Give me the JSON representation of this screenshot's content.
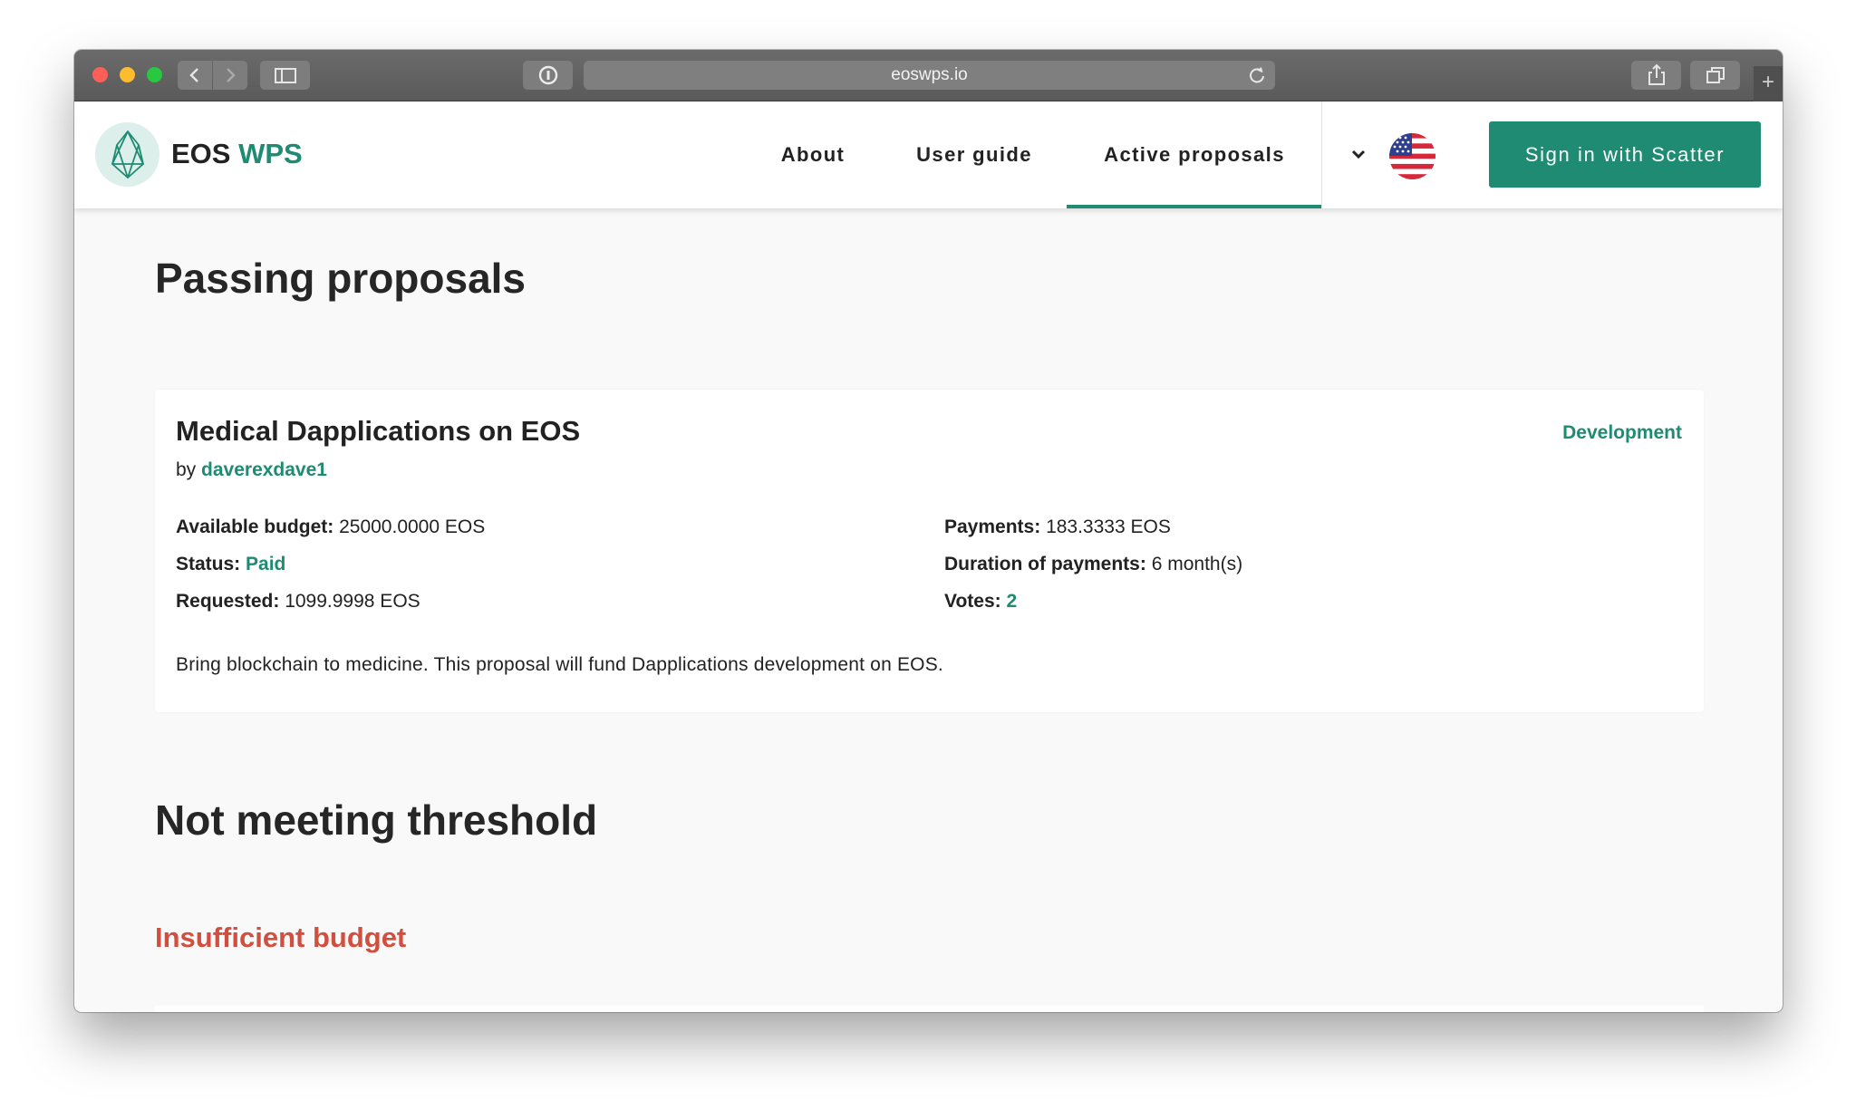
{
  "browser": {
    "url": "eoswps.io",
    "new_tab_label": "+"
  },
  "header": {
    "brand_primary": "EOS",
    "brand_accent": "WPS",
    "nav": [
      {
        "label": "About"
      },
      {
        "label": "User guide"
      },
      {
        "label": "Active proposals",
        "active": true
      }
    ],
    "language_flag": "us-flag-icon",
    "signin_label": "Sign in with Scatter"
  },
  "colors": {
    "accent": "#1f8b73",
    "warning": "#d04f3f",
    "text": "#222222",
    "page_bg": "#f9f9f9"
  },
  "sections": {
    "passing_title": "Passing proposals",
    "not_meeting_title": "Not meeting threshold",
    "insufficient_title": "Insufficient budget"
  },
  "proposal": {
    "title": "Medical Dapplications on EOS",
    "category": "Development",
    "by_prefix": "by",
    "author": "daverexdave1",
    "available_budget_label": "Available budget:",
    "available_budget_value": "25000.0000 EOS",
    "status_label": "Status:",
    "status_value": "Paid",
    "requested_label": "Requested:",
    "requested_value": "1099.9998 EOS",
    "payments_label": "Payments:",
    "payments_value": "183.3333 EOS",
    "duration_label": "Duration of payments:",
    "duration_value": "6 month(s)",
    "votes_label": "Votes:",
    "votes_value": "2",
    "description": "Bring blockchain to medicine. This proposal will fund Dapplications development on EOS."
  }
}
